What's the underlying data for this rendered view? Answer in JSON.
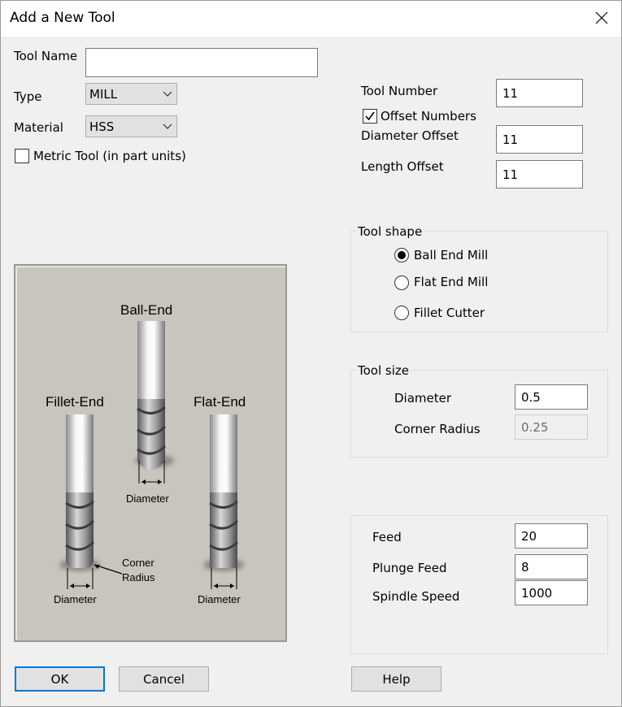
{
  "window": {
    "title": "Add a New Tool"
  },
  "form": {
    "tool_name": {
      "label": "Tool Name",
      "value": ""
    },
    "type": {
      "label": "Type",
      "value": "MILL"
    },
    "material": {
      "label": "Material",
      "value": "HSS"
    },
    "metric": {
      "label": "Metric Tool (in part units)",
      "checked": false
    },
    "tool_number": {
      "label": "Tool Number",
      "value": "11"
    },
    "offset_numbers": {
      "label": "Offset Numbers",
      "checked": true
    },
    "diameter_offset": {
      "label": "Diameter Offset",
      "value": "11"
    },
    "length_offset": {
      "label": "Length Offset",
      "value": "11"
    }
  },
  "tool_shape": {
    "legend": "Tool shape",
    "options": [
      {
        "label": "Ball End Mill",
        "selected": true
      },
      {
        "label": "Flat End Mill",
        "selected": false
      },
      {
        "label": "Fillet Cutter",
        "selected": false
      }
    ]
  },
  "tool_size": {
    "legend": "Tool size",
    "diameter": {
      "label": "Diameter",
      "value": "0.5"
    },
    "corner_radius": {
      "label": "Corner Radius",
      "value": "0.25",
      "disabled": true
    }
  },
  "speeds": {
    "feed": {
      "label": "Feed",
      "value": "20"
    },
    "plunge_feed": {
      "label": "Plunge Feed",
      "value": "8"
    },
    "spindle_speed": {
      "label": "Spindle Speed",
      "value": "1000"
    }
  },
  "illustration": {
    "ball_end": "Ball-End",
    "fillet_end": "Fillet-End",
    "flat_end": "Flat-End",
    "diameter": "Diameter",
    "corner_radius_line1": "Corner",
    "corner_radius_line2": "Radius"
  },
  "buttons": {
    "ok": "OK",
    "cancel": "Cancel",
    "help": "Help"
  },
  "colors": {
    "accent": "#0078d7",
    "dialog_bg": "#f0f0f0",
    "illustration_bg": "#c8c5be"
  }
}
